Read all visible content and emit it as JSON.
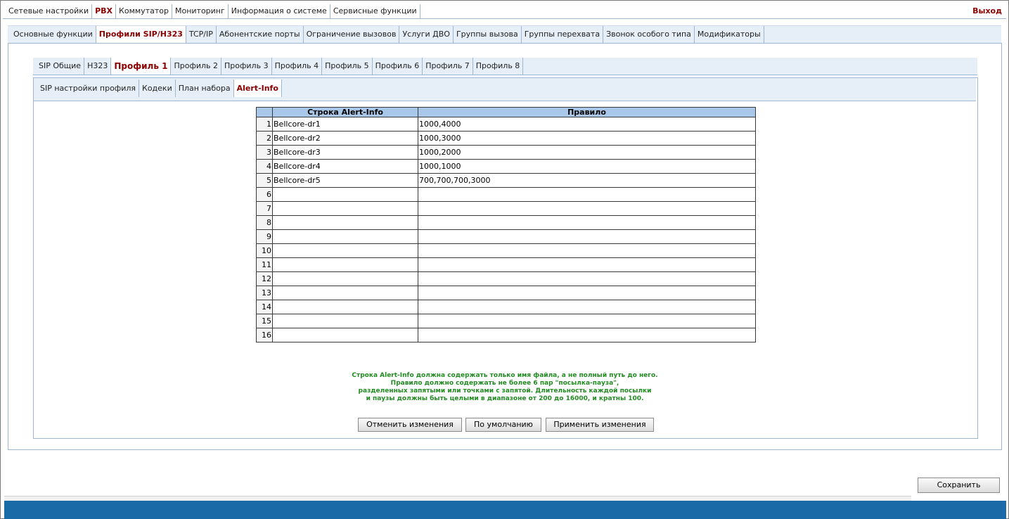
{
  "top_menu": {
    "items": [
      {
        "label": "Сетевые настройки",
        "active": false
      },
      {
        "label": "PBX",
        "active": true
      },
      {
        "label": "Коммутатор",
        "active": false
      },
      {
        "label": "Мониторинг",
        "active": false
      },
      {
        "label": "Информация о системе",
        "active": false
      },
      {
        "label": "Сервисные функции",
        "active": false
      }
    ],
    "logout": "Выход"
  },
  "pbx_menu": {
    "items": [
      {
        "label": "Основные функции",
        "active": false
      },
      {
        "label": "Профили SIP/H323",
        "active": true
      },
      {
        "label": "TCP/IP",
        "active": false
      },
      {
        "label": "Абонентские порты",
        "active": false
      },
      {
        "label": "Ограничение вызовов",
        "active": false
      },
      {
        "label": "Услуги ДВО",
        "active": false
      },
      {
        "label": "Группы вызова",
        "active": false
      },
      {
        "label": "Группы перехвата",
        "active": false
      },
      {
        "label": "Звонок особого типа",
        "active": false
      },
      {
        "label": "Модификаторы",
        "active": false
      }
    ]
  },
  "profile_tabs": {
    "items": [
      {
        "label": "SIP Общие",
        "active": false
      },
      {
        "label": "H323",
        "active": false
      },
      {
        "label": "Профиль 1",
        "active": true
      },
      {
        "label": "Профиль 2",
        "active": false
      },
      {
        "label": "Профиль 3",
        "active": false
      },
      {
        "label": "Профиль 4",
        "active": false
      },
      {
        "label": "Профиль 5",
        "active": false
      },
      {
        "label": "Профиль 6",
        "active": false
      },
      {
        "label": "Профиль 7",
        "active": false
      },
      {
        "label": "Профиль 8",
        "active": false
      }
    ]
  },
  "sub_tabs": {
    "items": [
      {
        "label": "SIP настройки профиля",
        "active": false
      },
      {
        "label": "Кодеки",
        "active": false
      },
      {
        "label": "План набора",
        "active": false
      },
      {
        "label": "Alert-Info",
        "active": true
      }
    ]
  },
  "table": {
    "headers": {
      "num": "",
      "alert": "Строка Alert-Info",
      "rule": "Правило"
    },
    "rows": [
      {
        "num": "1",
        "alert": "Bellcore-dr1",
        "rule": "1000,4000"
      },
      {
        "num": "2",
        "alert": "Bellcore-dr2",
        "rule": "1000,3000"
      },
      {
        "num": "3",
        "alert": "Bellcore-dr3",
        "rule": "1000,2000"
      },
      {
        "num": "4",
        "alert": "Bellcore-dr4",
        "rule": "1000,1000"
      },
      {
        "num": "5",
        "alert": "Bellcore-dr5",
        "rule": "700,700,700,3000"
      },
      {
        "num": "6",
        "alert": "",
        "rule": ""
      },
      {
        "num": "7",
        "alert": "",
        "rule": ""
      },
      {
        "num": "8",
        "alert": "",
        "rule": ""
      },
      {
        "num": "9",
        "alert": "",
        "rule": ""
      },
      {
        "num": "10",
        "alert": "",
        "rule": ""
      },
      {
        "num": "11",
        "alert": "",
        "rule": ""
      },
      {
        "num": "12",
        "alert": "",
        "rule": ""
      },
      {
        "num": "13",
        "alert": "",
        "rule": ""
      },
      {
        "num": "14",
        "alert": "",
        "rule": ""
      },
      {
        "num": "15",
        "alert": "",
        "rule": ""
      },
      {
        "num": "16",
        "alert": "",
        "rule": ""
      }
    ]
  },
  "note": {
    "lines": [
      "Строка Alert-Info должна содержать только имя файла, а не полный путь до него.",
      "Правило должно содержать не более 6 пар \"посылка-пауза\",",
      "разделенных запятыми или точками с запятой. Длительность каждой посылки",
      "и паузы должны быть целыми в диапазоне от 200 до 16000, и кратны 100."
    ]
  },
  "buttons": {
    "cancel": "Отменить изменения",
    "default": "По умолчанию",
    "apply": "Применить изменения",
    "save": "Сохранить"
  },
  "colors": {
    "active_tab_text": "#8b0000",
    "tab_bar_bg": "#e6eef8",
    "table_header_bg": "#a9c7e8",
    "note_text": "#228b22",
    "footer_bg": "#1a6aa8"
  }
}
